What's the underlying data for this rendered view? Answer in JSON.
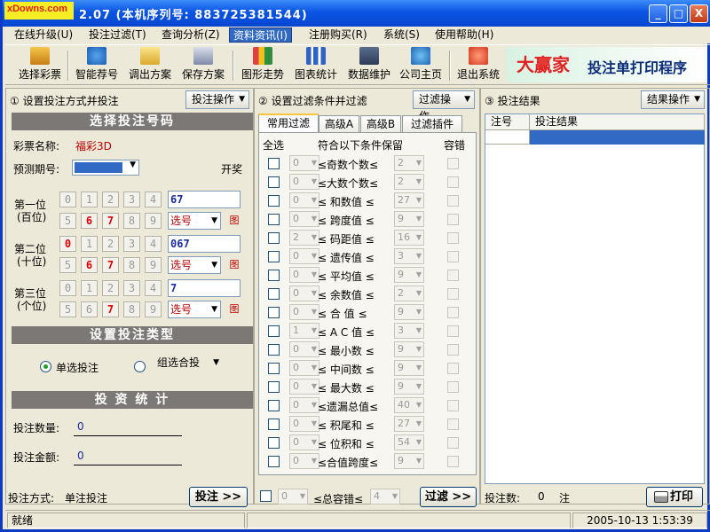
{
  "window": {
    "logo_text": "xDowns.com",
    "title": "2.07 (本机序列号: 883725381544)",
    "min": "_",
    "max": "□",
    "close": "X"
  },
  "menu": [
    "在线升级(U)",
    "投注过滤(T)",
    "查询分析(Z)",
    "资料资讯(I)",
    "注册购买(R)",
    "系统(S)",
    "使用帮助(H)"
  ],
  "toolbar": [
    "选择彩票",
    "智能荐号",
    "调出方案",
    "保存方案",
    "图形走势",
    "图表统计",
    "数据维护",
    "公司主页",
    "退出系统"
  ],
  "banner": {
    "brand": "大赢家",
    "subtitle": "投注单打印程序"
  },
  "panel1": {
    "header": "① 设置投注方式并投注",
    "menu_btn": "投注操作",
    "sect_numbers": "选择投注号码",
    "lottery_label": "彩票名称:",
    "lottery_name": "福彩3D",
    "period_label": "预测期号:",
    "draw_label": "开奖",
    "positions": [
      {
        "name": "第一位",
        "sub": "(百位)",
        "row1": [
          "0",
          "1",
          "2",
          "3",
          "4"
        ],
        "row2": [
          "5",
          "6",
          "7",
          "8",
          "9"
        ],
        "value": "67",
        "sel_label": "选号",
        "chart": "图"
      },
      {
        "name": "第二位",
        "sub": "(十位)",
        "row1": [
          "0",
          "1",
          "2",
          "3",
          "4"
        ],
        "row2": [
          "5",
          "6",
          "7",
          "8",
          "9"
        ],
        "value": "067",
        "sel_label": "选号",
        "chart": "图"
      },
      {
        "name": "第三位",
        "sub": "(个位)",
        "row1": [
          "0",
          "1",
          "2",
          "3",
          "4"
        ],
        "row2": [
          "5",
          "6",
          "7",
          "8",
          "9"
        ],
        "value": "7",
        "sel_label": "选号",
        "chart": "图"
      }
    ],
    "sect_type": "设置投注类型",
    "single": "单选投注",
    "group": "组选合投",
    "sect_stats": "投 资 统 计",
    "count_label": "投注数量:",
    "count_value": "0",
    "amount_label": "投注金额:",
    "amount_value": "0",
    "mode_label": "投注方式:",
    "mode_value": "单注投注",
    "bet_btn": "投注 >>"
  },
  "panel2": {
    "header": "② 设置过滤条件并过滤",
    "menu_btn": "过滤操作",
    "tabs": [
      "常用过滤",
      "高级A",
      "高级B",
      "过滤插件"
    ],
    "col_all": "全选",
    "col_cond": "符合以下条件保留",
    "col_tol": "容错",
    "rows": [
      {
        "lo": "0",
        "label": "≤奇数个数≤",
        "hi": "2"
      },
      {
        "lo": "0",
        "label": "≤大数个数≤",
        "hi": "2"
      },
      {
        "lo": "0",
        "label": "≤ 和数值 ≤",
        "hi": "27"
      },
      {
        "lo": "0",
        "label": "≤ 跨度值 ≤",
        "hi": "9"
      },
      {
        "lo": "2",
        "label": "≤ 码距值 ≤",
        "hi": "16"
      },
      {
        "lo": "0",
        "label": "≤ 遗传值 ≤",
        "hi": "3"
      },
      {
        "lo": "0",
        "label": "≤ 平均值 ≤",
        "hi": "9"
      },
      {
        "lo": "0",
        "label": "≤ 余数值 ≤",
        "hi": "2"
      },
      {
        "lo": "0",
        "label": "≤ 合 值 ≤",
        "hi": "9"
      },
      {
        "lo": "1",
        "label": "≤ A C 值 ≤",
        "hi": "3"
      },
      {
        "lo": "0",
        "label": "≤ 最小数 ≤",
        "hi": "9"
      },
      {
        "lo": "0",
        "label": "≤ 中间数 ≤",
        "hi": "9"
      },
      {
        "lo": "0",
        "label": "≤ 最大数 ≤",
        "hi": "9"
      },
      {
        "lo": "0",
        "label": "≤遗漏总值≤",
        "hi": "40"
      },
      {
        "lo": "0",
        "label": "≤ 积尾和 ≤",
        "hi": "27"
      },
      {
        "lo": "0",
        "label": "≤ 位积和 ≤",
        "hi": "54"
      },
      {
        "lo": "0",
        "label": "≤合值跨度≤",
        "hi": "9"
      }
    ],
    "bottom_lo": "0",
    "bottom_label": "≤总容错≤",
    "bottom_hi": "4",
    "filter_btn": "过滤 >>"
  },
  "panel3": {
    "header": "③ 投注结果",
    "menu_btn": "结果操作",
    "col1": "注号",
    "col2": "投注结果",
    "count_label": "投注数:",
    "count_value": "0",
    "count_unit": "注",
    "print_btn": "打印"
  },
  "status": {
    "left": "就绪",
    "datetime": "2005-10-13 1:53:39"
  },
  "colors": {
    "titlebar": "#0A54E4",
    "accent": "#316AC5",
    "section": "#7B7875",
    "number_red": "#E00000"
  },
  "icons": [
    "lottery-icon",
    "recommend-icon",
    "load-icon",
    "save-icon",
    "trend-icon",
    "stats-icon",
    "data-icon",
    "home-icon",
    "exit-icon",
    "printer-icon"
  ]
}
